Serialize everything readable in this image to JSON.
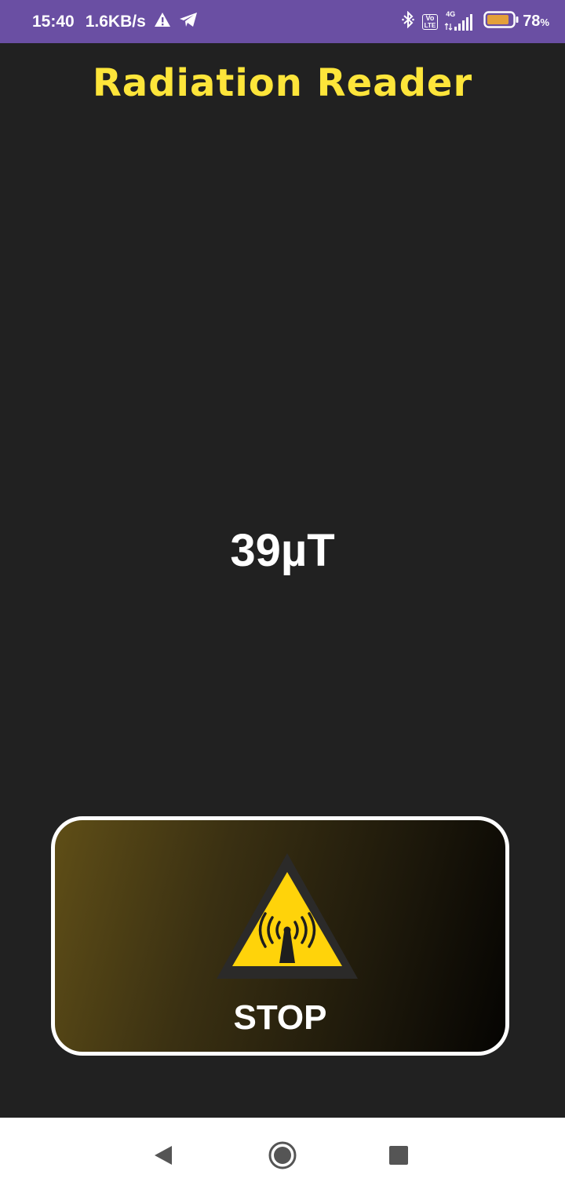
{
  "status_bar": {
    "time": "15:40",
    "net_speed": "1.6KB/s",
    "battery_percent": "78",
    "battery_unit": "%",
    "volte_label_top": "Vo",
    "volte_label_bottom": "LTE",
    "network_type": "4G",
    "background_color": "#6a4fa3",
    "icons": [
      "warning-icon",
      "telegram-icon",
      "bluetooth-icon",
      "volte-icon",
      "signal-icon",
      "battery-icon"
    ]
  },
  "app": {
    "title": "Radiation Reader",
    "title_color": "#fde53a",
    "reading": "39µT",
    "background_color": "#212121"
  },
  "stop_button": {
    "label": "STOP",
    "icon": "radiation-warning-icon",
    "icon_color": "#ffd30a"
  },
  "nav_bar": {
    "buttons": [
      "back-icon",
      "home-icon",
      "recents-icon"
    ]
  }
}
